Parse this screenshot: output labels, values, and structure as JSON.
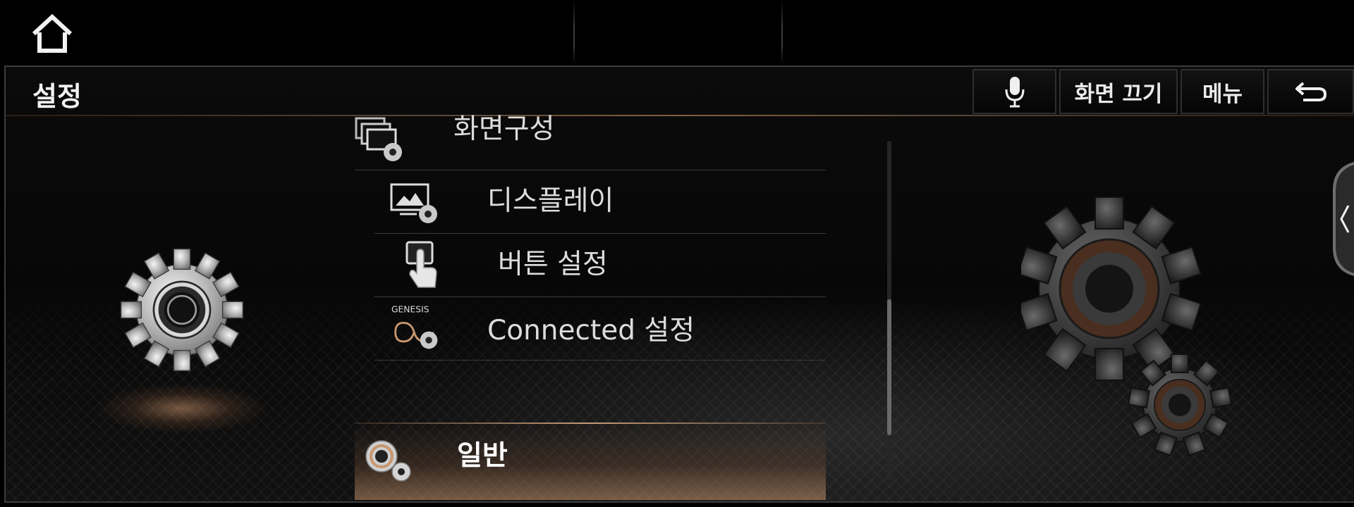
{
  "status_bar": {
    "home_icon": "home-icon"
  },
  "header": {
    "title": "설정",
    "buttons": {
      "voice_icon": "microphone-icon",
      "screen_off": "화면 끄기",
      "menu": "메뉴",
      "back_icon": "back-arrow-icon"
    }
  },
  "list": {
    "items": [
      {
        "label": "화면구성",
        "icon": "screen-layout-settings-icon",
        "selected": false
      },
      {
        "label": "디스플레이",
        "icon": "display-settings-icon",
        "selected": false
      },
      {
        "label": "버튼 설정",
        "icon": "button-settings-icon",
        "selected": false
      },
      {
        "label": "Connected 설정",
        "icon": "genesis-connected-settings-icon",
        "logo_text": "GENESIS",
        "selected": false
      },
      {
        "label": "일반",
        "icon": "general-settings-icon",
        "selected": true
      }
    ]
  },
  "scrollbar": {
    "position": 0.78,
    "visible_fraction": 0.4
  },
  "colors": {
    "accent": "#c8966e",
    "background": "#000000",
    "text": "#e6e6e6"
  }
}
